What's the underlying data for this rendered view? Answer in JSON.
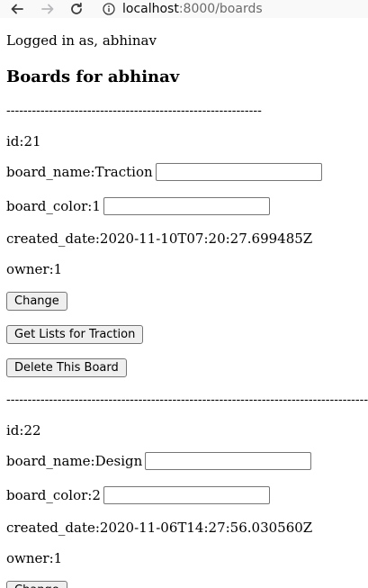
{
  "browser": {
    "url_host": "localhost",
    "url_rest": ":8000/boards"
  },
  "page": {
    "logged_in_text": "Logged in as, abhinav",
    "heading": "Boards for abhinav",
    "divider_short": "------------------------------------------------------------",
    "divider_long": "--------------------------------------------------------------------------------------------"
  },
  "boards": [
    {
      "id_text": "id:21",
      "name_label": "board_name:Traction",
      "name_value": "",
      "color_label": "board_color:1",
      "color_value": "",
      "created_text": "created_date:2020-11-10T07:20:27.699485Z",
      "owner_text": "owner:1",
      "change_label": "Change",
      "get_lists_label": "Get Lists for Traction",
      "delete_label": "Delete This Board"
    },
    {
      "id_text": "id:22",
      "name_label": "board_name:Design",
      "name_value": "",
      "color_label": "board_color:2",
      "color_value": "",
      "created_text": "created_date:2020-11-06T14:27:56.030560Z",
      "owner_text": "owner:1",
      "change_label": "Change"
    }
  ]
}
